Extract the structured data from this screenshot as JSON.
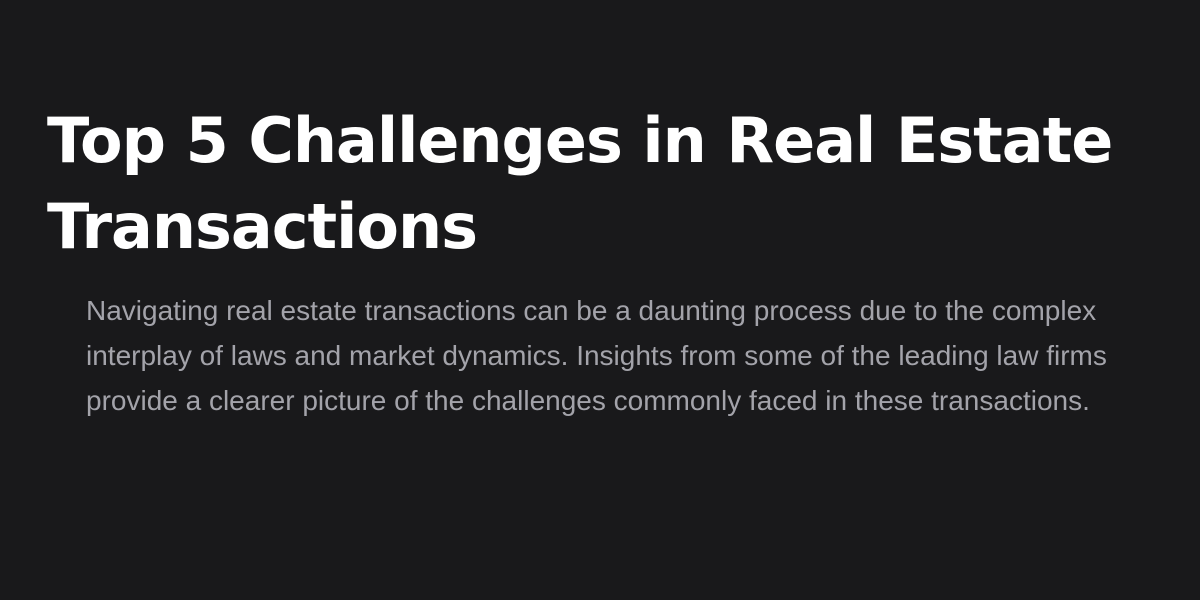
{
  "article": {
    "title": "Top 5 Challenges in Real Estate Transactions",
    "intro": "Navigating real estate transactions can be a daunting process due to the complex interplay of laws and market dynamics. Insights from some of the leading law firms provide a clearer picture of the challenges commonly faced in these transactions."
  },
  "colors": {
    "background": "#19191b",
    "title": "#ffffff",
    "body_text": "#a3a3aa"
  }
}
